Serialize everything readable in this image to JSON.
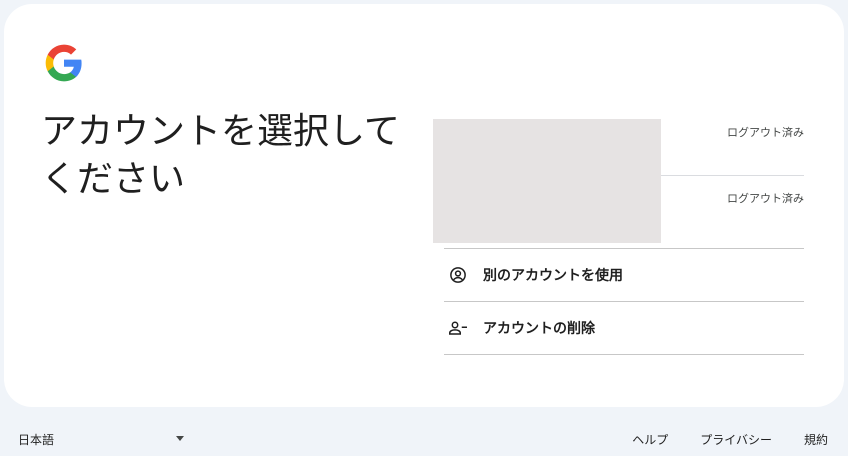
{
  "header": {
    "title": "アカウントを選択してください"
  },
  "accounts": [
    {
      "status": "ログアウト済み"
    },
    {
      "status": "ログアウト済み"
    }
  ],
  "actions": {
    "use_another": "別のアカウントを使用",
    "remove": "アカウントの削除"
  },
  "footer": {
    "language": "日本語",
    "help": "ヘルプ",
    "privacy": "プライバシー",
    "terms": "規約"
  },
  "icons": {
    "logo": "google-logo-icon",
    "use_another": "account-circle-icon",
    "remove": "person-remove-icon",
    "language_dropdown": "caret-down-icon"
  },
  "colors": {
    "background": "#f0f4f9",
    "card": "#ffffff",
    "google_blue": "#4285f4",
    "google_red": "#ea4335",
    "google_yellow": "#fbbc05",
    "google_green": "#34a853"
  }
}
